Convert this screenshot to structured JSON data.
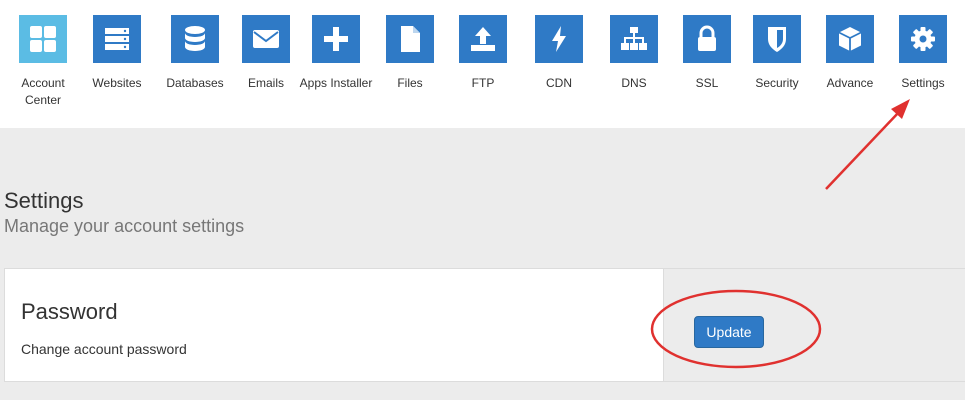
{
  "nav": {
    "items": [
      {
        "label": "Account Center",
        "icon": "grid-icon",
        "active": true
      },
      {
        "label": "Websites",
        "icon": "server-icon"
      },
      {
        "label": "Databases",
        "icon": "database-icon"
      },
      {
        "label": "Emails",
        "icon": "envelope-icon"
      },
      {
        "label": "Apps Installer",
        "icon": "plus-icon"
      },
      {
        "label": "Files",
        "icon": "file-icon"
      },
      {
        "label": "FTP",
        "icon": "upload-icon"
      },
      {
        "label": "CDN",
        "icon": "bolt-icon"
      },
      {
        "label": "DNS",
        "icon": "sitemap-icon"
      },
      {
        "label": "SSL",
        "icon": "lock-icon"
      },
      {
        "label": "Security",
        "icon": "shield-icon"
      },
      {
        "label": "Advance",
        "icon": "cube-icon"
      },
      {
        "label": "Settings",
        "icon": "gear-icon"
      }
    ]
  },
  "page": {
    "title": "Settings",
    "subtitle": "Manage your account settings"
  },
  "password_panel": {
    "title": "Password",
    "description": "Change account password",
    "button_label": "Update"
  },
  "colors": {
    "tile": "#2f7ac6",
    "tile_active": "#5bbce4",
    "annotation": "#e0312f"
  }
}
